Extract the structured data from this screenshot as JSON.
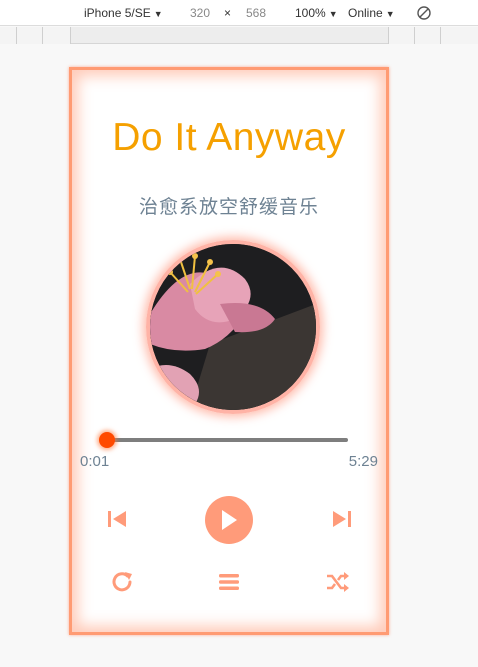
{
  "devtools": {
    "device": "iPhone 5/SE",
    "width": "320",
    "times": "×",
    "height": "568",
    "zoom": "100%",
    "throttle": "Online"
  },
  "player": {
    "title": "Do It Anyway",
    "subtitle": "治愈系放空舒缓音乐",
    "current_time": "0:01",
    "total_time": "5:29",
    "progress": 0.003
  },
  "colors": {
    "accent": "#ff9b7a",
    "title": "#f5a000",
    "text": "#6e8293",
    "thumb": "#ff4a00"
  },
  "icons": [
    "previous-icon",
    "play-icon",
    "next-icon",
    "repeat-icon",
    "playlist-icon",
    "shuffle-icon",
    "rotate-icon"
  ]
}
